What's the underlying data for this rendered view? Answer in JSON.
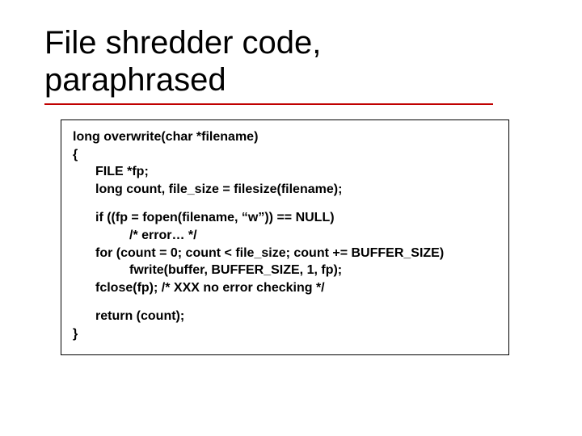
{
  "title_line1": "File shredder code,",
  "title_line2": "paraphrased",
  "code": {
    "l1": "long overwrite(char *filename)",
    "l2": "{",
    "l3": "FILE *fp;",
    "l4": "long count, file_size = filesize(filename);",
    "l5": "if ((fp = fopen(filename, “w”)) == NULL)",
    "l6": "/* error… */",
    "l7": "for (count = 0; count < file_size; count += BUFFER_SIZE)",
    "l8": "fwrite(buffer, BUFFER_SIZE, 1, fp);",
    "l9": "fclose(fp); /* XXX no error checking */",
    "l10": "return (count);",
    "l11": "}"
  }
}
